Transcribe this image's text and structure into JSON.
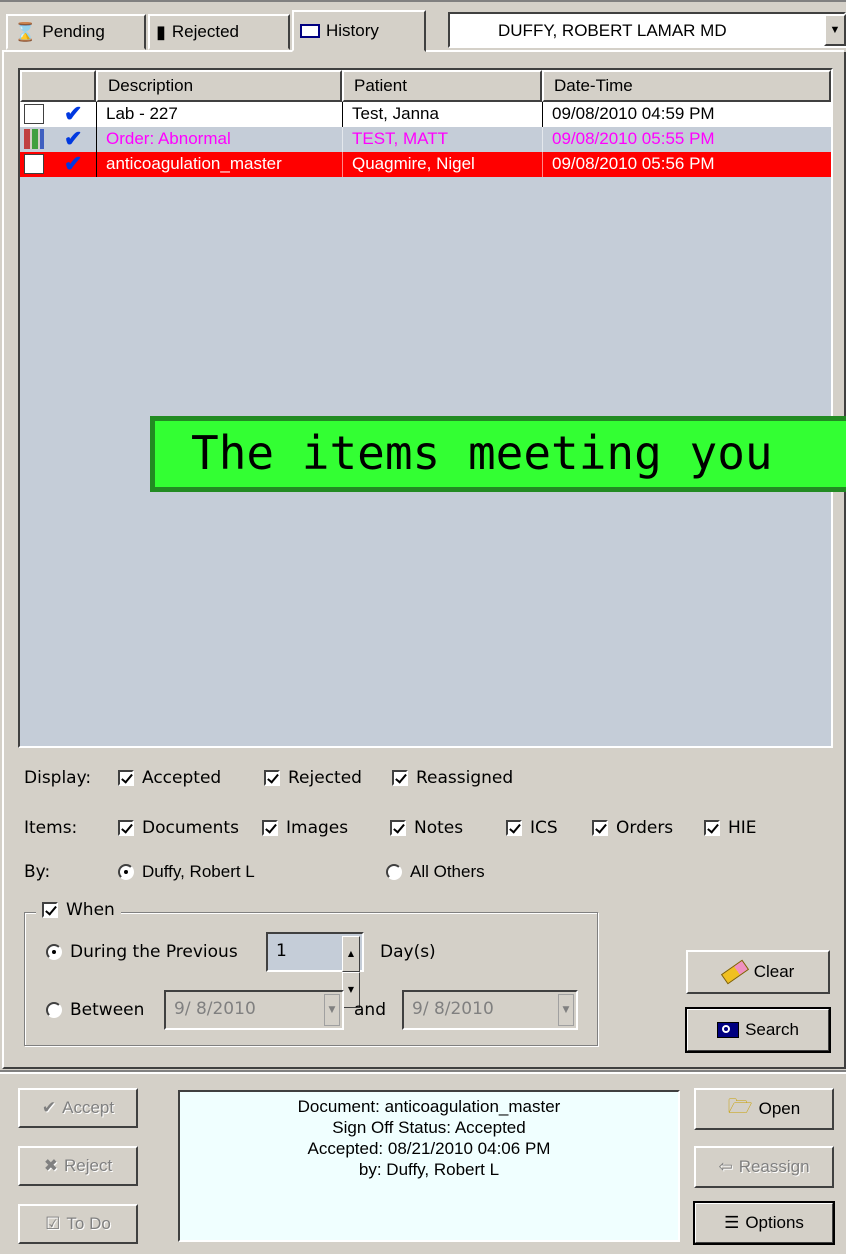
{
  "tabs": [
    {
      "label": "Pending",
      "icon": "hourglass-icon"
    },
    {
      "label": "Rejected",
      "icon": "rejected-icon"
    },
    {
      "label": "History",
      "icon": "history-icon"
    }
  ],
  "provider_select": {
    "value": "DUFFY, ROBERT LAMAR MD"
  },
  "list": {
    "columns": [
      "Description",
      "Patient",
      "Date-Time"
    ],
    "rows": [
      {
        "description": "Lab - 227",
        "patient": "Test, Janna",
        "datetime": "09/08/2010 04:59 PM",
        "icon": "lab-report-icon",
        "text_color": "#000000",
        "bg": "#ffffff"
      },
      {
        "description": "Order: Abnormal",
        "patient": "TEST, MATT",
        "datetime": "09/08/2010 05:55 PM",
        "icon": "order-icon",
        "text_color": "#ff00ff",
        "bg": "#c5cdd8"
      },
      {
        "description": "anticoagulation_master",
        "patient": "Quagmire, Nigel",
        "datetime": "09/08/2010 05:56 PM",
        "icon": "document-icon",
        "text_color": "#ffffff",
        "bg": "#ff0000"
      }
    ]
  },
  "banner": {
    "text": "The items meeting you"
  },
  "filters": {
    "display_label": "Display:",
    "display": [
      "Accepted",
      "Rejected",
      "Reassigned"
    ],
    "items_label": "Items:",
    "items": [
      "Documents",
      "Images",
      "Notes",
      "ICS",
      "Orders",
      "HIE"
    ],
    "by_label": "By:",
    "by_self": "Duffy, Robert L",
    "by_others": "All Others",
    "when_label": "When",
    "during_label": "During the Previous",
    "during_value": "1",
    "days_label": "Day(s)",
    "between_label": "Between",
    "between_from": "9/ 8/2010",
    "and_label": "and",
    "between_to": "9/ 8/2010"
  },
  "buttons": {
    "clear": "Clear",
    "search": "Search",
    "accept": "Accept",
    "reject": "Reject",
    "todo": "To Do",
    "open": "Open",
    "reassign": "Reassign",
    "options": "Options"
  },
  "status": {
    "line1": "Document: anticoagulation_master",
    "line2": "Sign Off Status: Accepted",
    "line3": "Accepted: 08/21/2010 04:06 PM",
    "line4": "by: Duffy, Robert L"
  },
  "colors": {
    "accent_check": "#0038e0",
    "banner_bg": "#33ff33",
    "selected_row": "#ff0000",
    "abnormal_text": "#ff00ff"
  }
}
